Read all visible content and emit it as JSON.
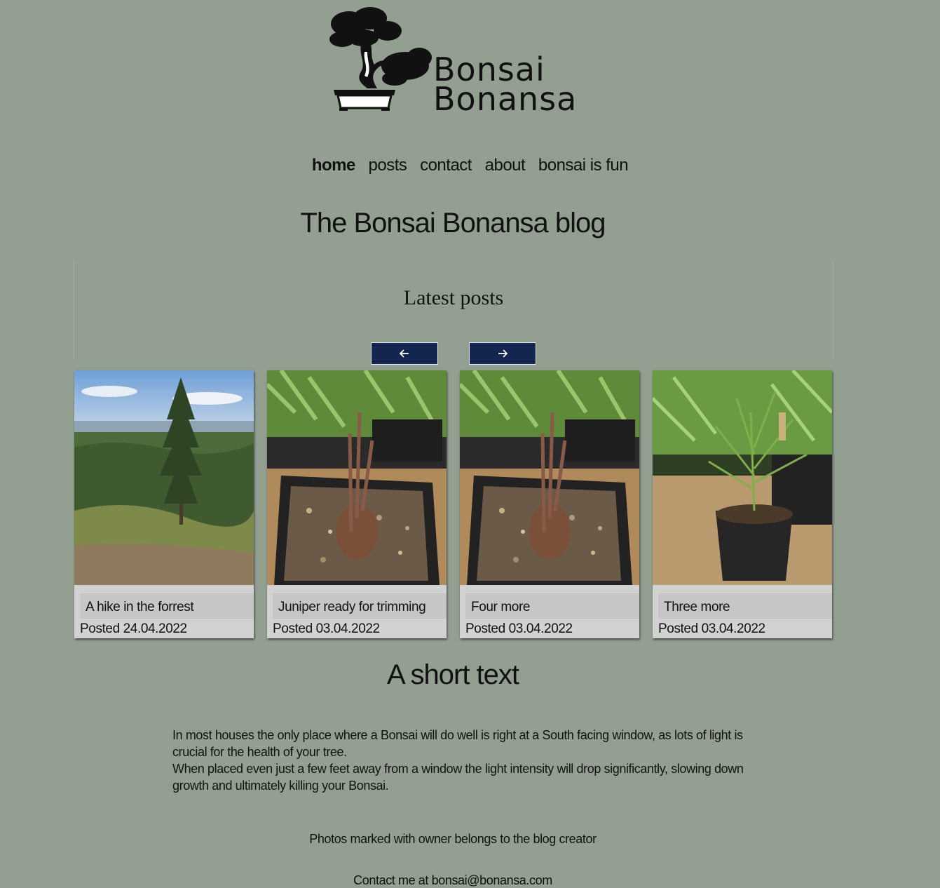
{
  "brand": {
    "line1": "Bonsai",
    "line2": "Bonansa"
  },
  "nav": {
    "items": [
      {
        "label": "home",
        "active": true
      },
      {
        "label": "posts",
        "active": false
      },
      {
        "label": "contact",
        "active": false
      },
      {
        "label": "about",
        "active": false
      },
      {
        "label": "bonsai is fun",
        "active": false
      }
    ]
  },
  "main": {
    "title": "The Bonsai Bonansa blog",
    "latest_heading": "Latest posts",
    "carousel": {
      "prev_icon": "arrow-left-icon",
      "next_icon": "arrow-right-icon",
      "button_color": "#12264f"
    },
    "posts": [
      {
        "title": "A hike in the forrest",
        "date": "Posted 24.04.2022",
        "photo": "forest-landscape"
      },
      {
        "title": "Juniper ready for trimming",
        "date": "Posted 03.04.2022",
        "photo": "potted-bonsai"
      },
      {
        "title": "Four more",
        "date": "Posted 03.04.2022",
        "photo": "potted-bonsai"
      },
      {
        "title": "Three more",
        "date": "Posted 03.04.2022",
        "photo": "pine-seedling"
      }
    ]
  },
  "short": {
    "title": "A short text",
    "p1": "In most houses the only place where a Bonsai will do well is right at a South facing window, as lots of light is crucial for the health of your tree.",
    "p2": "When placed even just a few feet away from a window the light intensity will drop significantly, slowing down growth and ultimately killing your Bonsai."
  },
  "footer": {
    "credits": "Photos marked with owner belongs to the blog creator",
    "contact": "Contact me at bonsai@bonansa.com"
  },
  "colors": {
    "background": "#93a091",
    "card": "#d2d2d2",
    "accent": "#12264f"
  }
}
